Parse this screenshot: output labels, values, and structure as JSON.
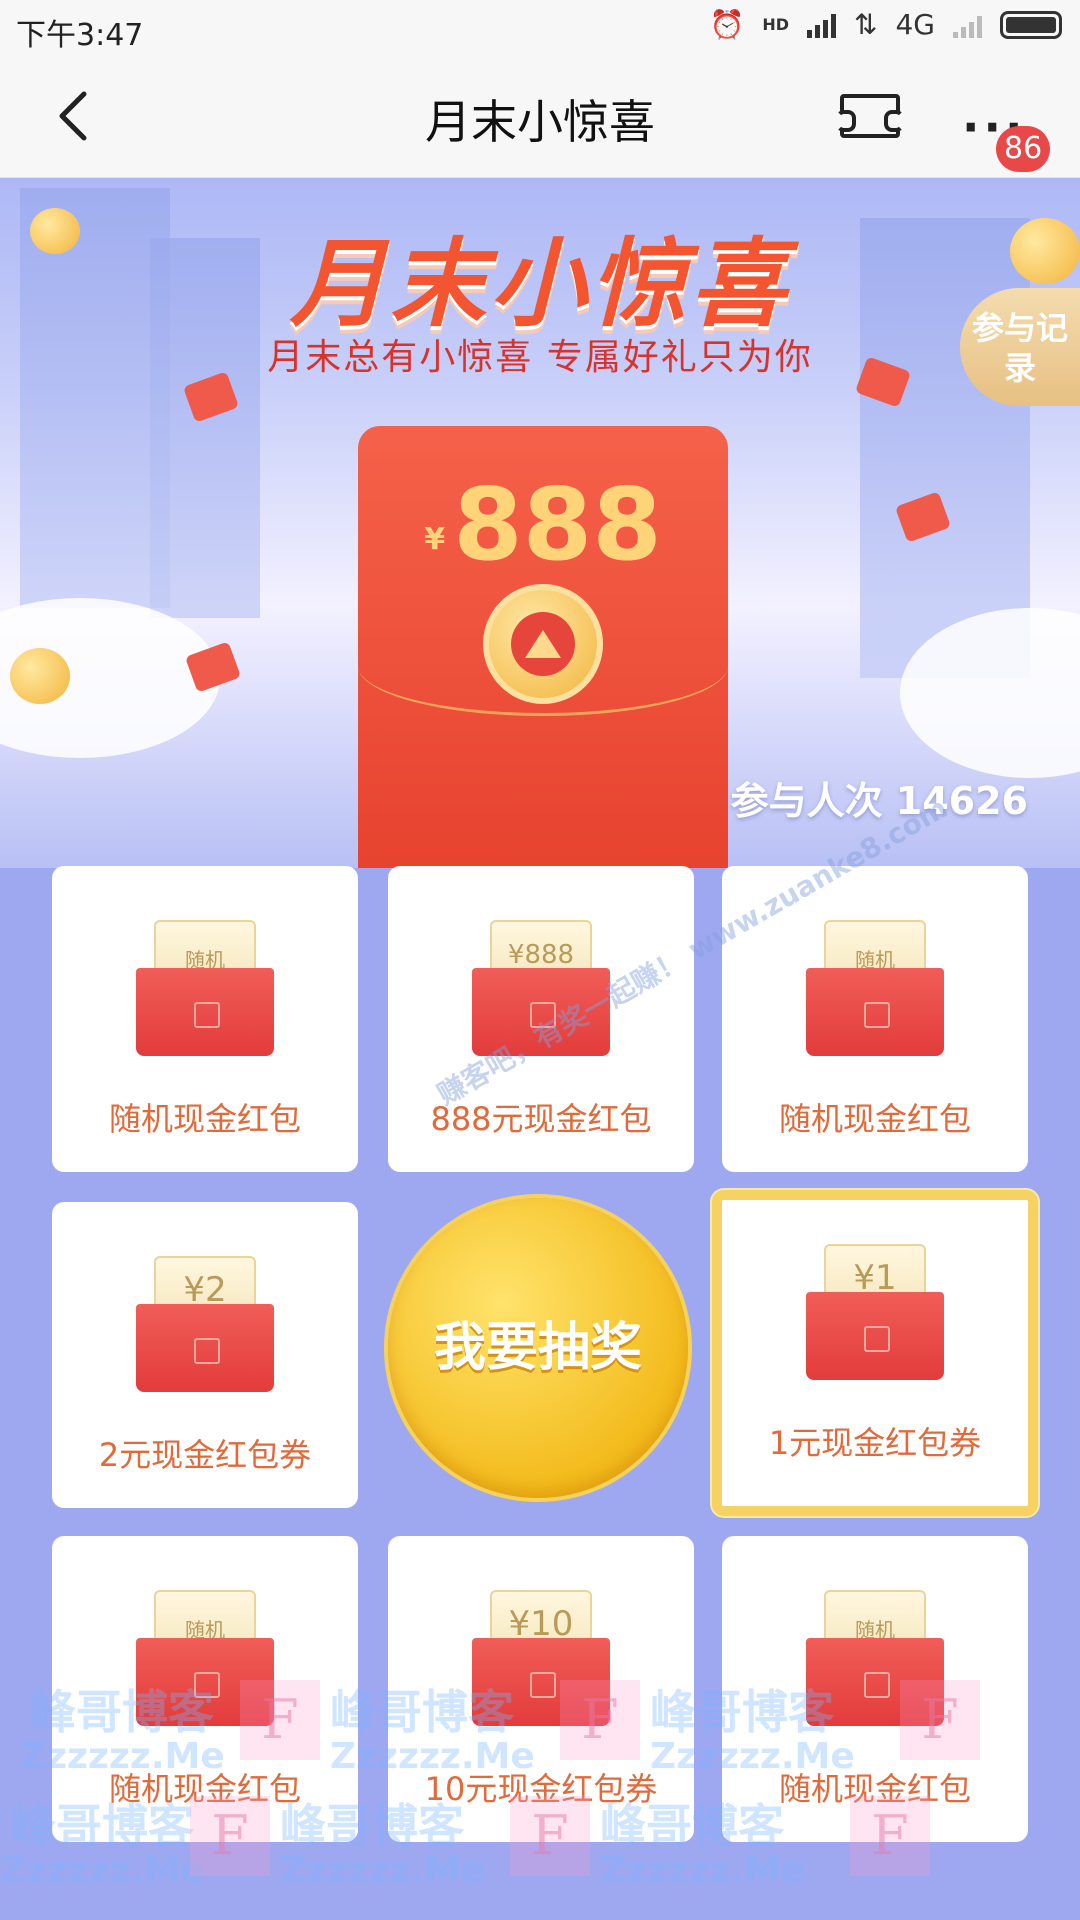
{
  "status_bar": {
    "time": "下午3:47",
    "network": "4G",
    "hd_label": "HD"
  },
  "nav": {
    "title": "月末小惊喜",
    "more_dots": "···",
    "badge_count": "86"
  },
  "hero": {
    "title": "月末小惊喜",
    "subtitle": "月末总有小惊喜  专属好礼只为你",
    "records_button": "参与记录",
    "envelope": {
      "currency": "¥",
      "amount": "888"
    },
    "participants_text": "参与人次 14626"
  },
  "prizes": [
    {
      "label": "随机现金红包",
      "ticket": "随机"
    },
    {
      "label": "888元现金红包",
      "ticket": "¥888"
    },
    {
      "label": "随机现金红包",
      "ticket": "随机"
    },
    {
      "label": "2元现金红包券",
      "ticket": "¥2"
    },
    {
      "label": "1元现金红包券",
      "ticket": "¥1",
      "selected": true
    },
    {
      "label": "随机现金红包",
      "ticket": "随机"
    },
    {
      "label": "10元现金红包券",
      "ticket": "¥10"
    },
    {
      "label": "随机现金红包",
      "ticket": "随机"
    }
  ],
  "draw_button": "我要抽奖",
  "watermarks": {
    "diagonal": "赚客吧，有奖一起赚！ www.zuanke8.com",
    "brand": "峰哥博客",
    "brand_url": "Zzzzzz.Me",
    "f_mark": "F"
  },
  "colors": {
    "page_background": "#9ea8f1",
    "title_red": "#f2552f",
    "label_orange": "#e06a3a",
    "gold": "#f3bb1c",
    "badge_red": "#e84848"
  }
}
